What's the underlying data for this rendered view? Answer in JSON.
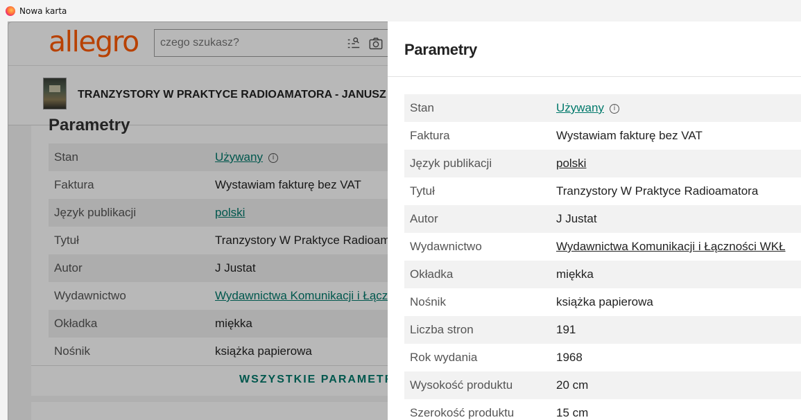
{
  "browser": {
    "tab_title": "Nowa karta"
  },
  "header": {
    "logo": "allegro",
    "search_placeholder": "czego szukasz?"
  },
  "product": {
    "title": "TRANZYSTORY W PRAKTYCE RADIOAMATORA - JANUSZ JU"
  },
  "background_section": {
    "heading": "Parametry",
    "rows": [
      {
        "label": "Stan",
        "value": "Używany"
      },
      {
        "label": "Faktura",
        "value": "Wystawiam fakturę bez VAT"
      },
      {
        "label": "Język publikacji",
        "value": "polski"
      },
      {
        "label": "Tytuł",
        "value": "Tranzystory W Praktyce Radioam"
      },
      {
        "label": "Autor",
        "value": "J Justat"
      },
      {
        "label": "Wydawnictwo",
        "value": "Wydawnictwa Komunikacji i Łącz"
      },
      {
        "label": "Okładka",
        "value": "miękka"
      },
      {
        "label": "Nośnik",
        "value": "książka papierowa"
      }
    ],
    "all_params_label": "WSZYSTKIE PARAMETRY"
  },
  "panel": {
    "title": "Parametry",
    "rows": [
      {
        "label": "Stan",
        "value": "Używany"
      },
      {
        "label": "Faktura",
        "value": "Wystawiam fakturę bez VAT"
      },
      {
        "label": "Język publikacji",
        "value": "polski"
      },
      {
        "label": "Tytuł",
        "value": "Tranzystory W Praktyce Radioamatora"
      },
      {
        "label": "Autor",
        "value": "J Justat"
      },
      {
        "label": "Wydawnictwo",
        "value": "Wydawnictwa Komunikacji i Łączności WKŁ"
      },
      {
        "label": "Okładka",
        "value": "miękka"
      },
      {
        "label": "Nośnik",
        "value": "książka papierowa"
      },
      {
        "label": "Liczba stron",
        "value": "191"
      },
      {
        "label": "Rok wydania",
        "value": "1968"
      },
      {
        "label": "Wysokość produktu",
        "value": "20 cm"
      },
      {
        "label": "Szerokość produktu",
        "value": "15 cm"
      }
    ]
  },
  "colors": {
    "brand": "#ff5a00",
    "link": "#00796b"
  },
  "icons": [
    "firefox-icon",
    "list-search-icon",
    "camera-icon",
    "info-icon"
  ]
}
